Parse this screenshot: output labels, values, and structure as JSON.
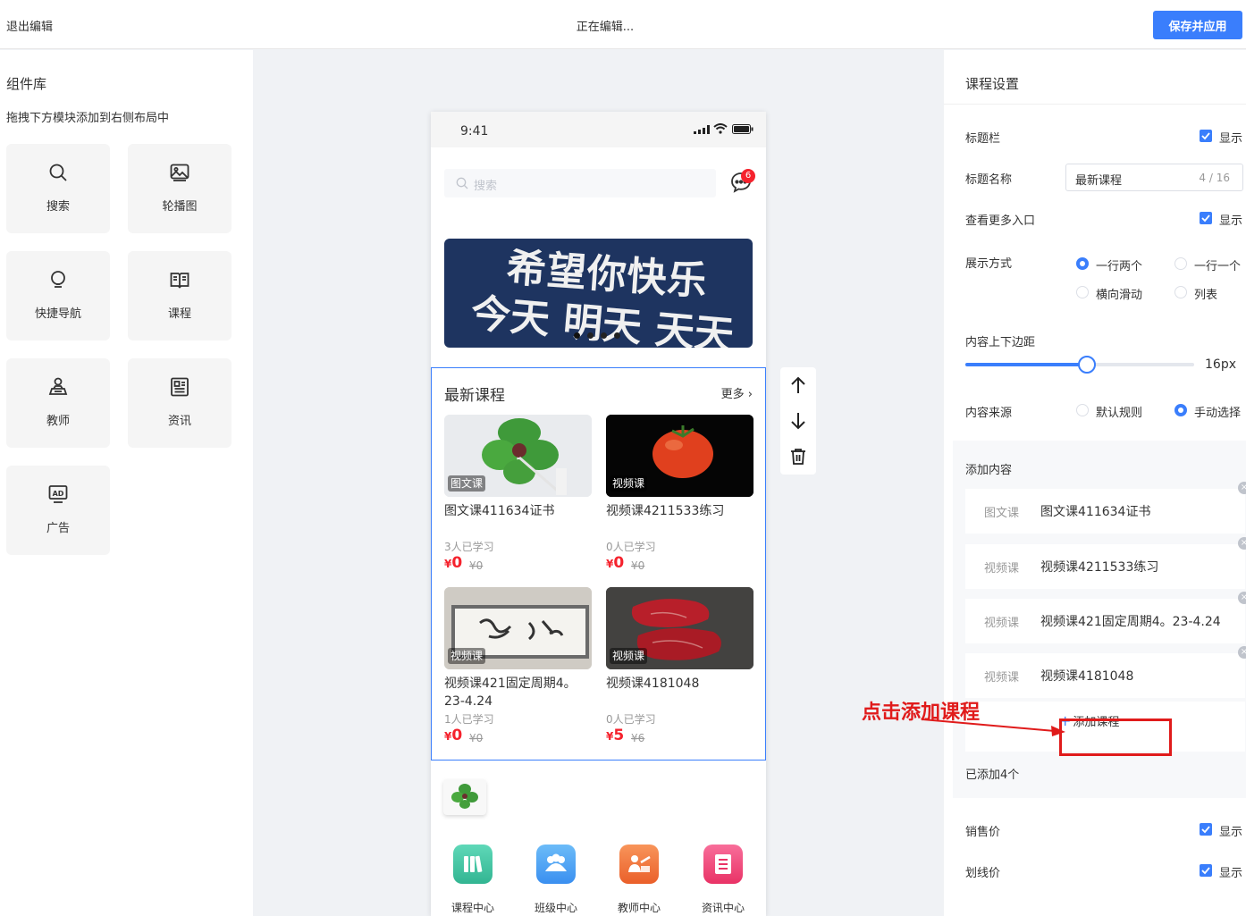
{
  "topbar": {
    "exit_label": "退出编辑",
    "status": "正在编辑...",
    "save_label": "保存并应用"
  },
  "library": {
    "title": "组件库",
    "hint": "拖拽下方模块添加到右侧布局中",
    "tiles": [
      {
        "label": "搜索",
        "icon": "search-icon"
      },
      {
        "label": "轮播图",
        "icon": "image-icon"
      },
      {
        "label": "快捷导航",
        "icon": "bulb-icon"
      },
      {
        "label": "课程",
        "icon": "book-icon"
      },
      {
        "label": "教师",
        "icon": "teacher-icon"
      },
      {
        "label": "资讯",
        "icon": "news-icon"
      },
      {
        "label": "广告",
        "icon": "ad-icon"
      }
    ]
  },
  "phone": {
    "time": "9:41",
    "search_placeholder": "搜索",
    "message_badge": "6",
    "banner": {
      "line1": "希望你快乐",
      "line2": "今天 明天 天天"
    },
    "section": {
      "title": "最新课程",
      "more": "更多",
      "cards": [
        {
          "tag": "图文课",
          "name": "图文课411634证书",
          "learners": "3人已学习",
          "price": "0",
          "original": "¥0"
        },
        {
          "tag": "视频课",
          "name": "视频课4211533练习",
          "learners": "0人已学习",
          "price": "0",
          "original": "¥0"
        },
        {
          "tag": "视频课",
          "name": "视频课421固定周期4。23-4.24",
          "learners": "1人已学习",
          "price": "0",
          "original": "¥0"
        },
        {
          "tag": "视频课",
          "name": "视频课4181048",
          "learners": "0人已学习",
          "price": "5",
          "original": "¥6"
        }
      ],
      "currency": "¥"
    },
    "nav": [
      {
        "label": "课程中心",
        "color": "#3fc7a6"
      },
      {
        "label": "班级中心",
        "color": "#4aa8f5"
      },
      {
        "label": "教师中心",
        "color": "#f07a3c"
      },
      {
        "label": "资讯中心",
        "color": "#f0457a"
      }
    ]
  },
  "settings": {
    "title": "课程设置",
    "title_bar": {
      "label": "标题栏",
      "check": "显示"
    },
    "title_name": {
      "label": "标题名称",
      "value": "最新课程",
      "count": "4 / 16"
    },
    "view_more": {
      "label": "查看更多入口",
      "check": "显示"
    },
    "display": {
      "label": "展示方式",
      "options": [
        "一行两个",
        "一行一个",
        "横向滑动",
        "列表"
      ],
      "selected": "一行两个"
    },
    "padding": {
      "label": "内容上下边距",
      "value": "16px",
      "fraction": 0.53
    },
    "source": {
      "label": "内容来源",
      "options": [
        "默认规则",
        "手动选择"
      ],
      "selected": "手动选择"
    },
    "content": {
      "label": "添加内容",
      "items": [
        {
          "type": "图文课",
          "name": "图文课411634证书"
        },
        {
          "type": "视频课",
          "name": "视频课4211533练习"
        },
        {
          "type": "视频课",
          "name": "视频课421固定周期4。23-4.24"
        },
        {
          "type": "视频课",
          "name": "视频课4181048"
        }
      ],
      "add_label": "添加课程",
      "count_text": "已添加4个"
    },
    "sale_price": {
      "label": "销售价",
      "check": "显示"
    },
    "strike_price": {
      "label": "划线价",
      "check": "显示"
    }
  },
  "annotation": {
    "text": "点击添加课程",
    "color": "#e01b1b"
  }
}
